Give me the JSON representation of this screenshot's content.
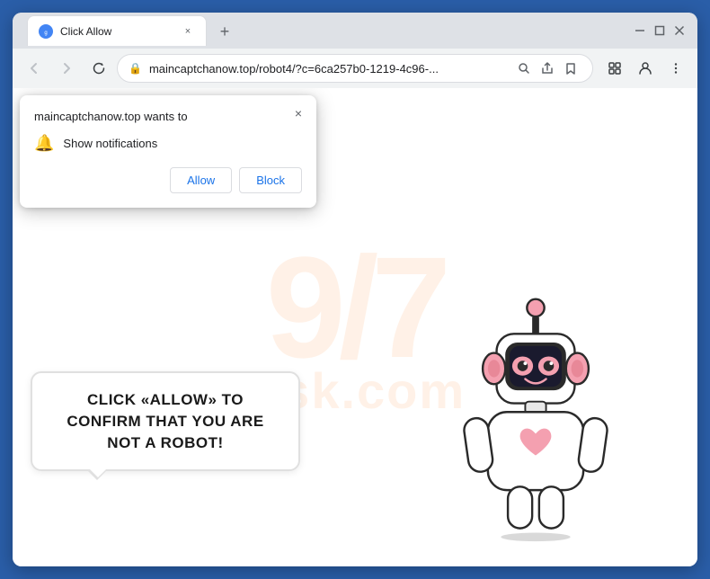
{
  "browser": {
    "title": "Click Allow",
    "tab": {
      "favicon": "🔵",
      "title": "Click Allow",
      "close": "×"
    },
    "new_tab": "+",
    "nav": {
      "back": "←",
      "forward": "→",
      "reload": "↻",
      "url": "maincaptchanow.top/robot4/?c=6ca257b0-1219-4c96-...",
      "lock": "🔒",
      "search_icon": "🔍",
      "share_icon": "⎙",
      "bookmark_icon": "☆",
      "extension_icon": "⬡",
      "profile_icon": "👤",
      "menu_icon": "⋮"
    }
  },
  "popup": {
    "title": "maincaptchanow.top wants to",
    "close": "×",
    "notification_label": "Show notifications",
    "allow_button": "Allow",
    "block_button": "Block"
  },
  "captcha": {
    "text": "CLICK «ALLOW» TO CONFIRM THAT YOU ARE NOT A ROBOT!"
  },
  "watermark": {
    "logo": "9/7",
    "text": "risk.co"
  },
  "colors": {
    "accent": "#1a73e8",
    "chrome_bg": "#dee1e6",
    "nav_bg": "#f1f3f4",
    "page_bg": "#ffffff"
  }
}
